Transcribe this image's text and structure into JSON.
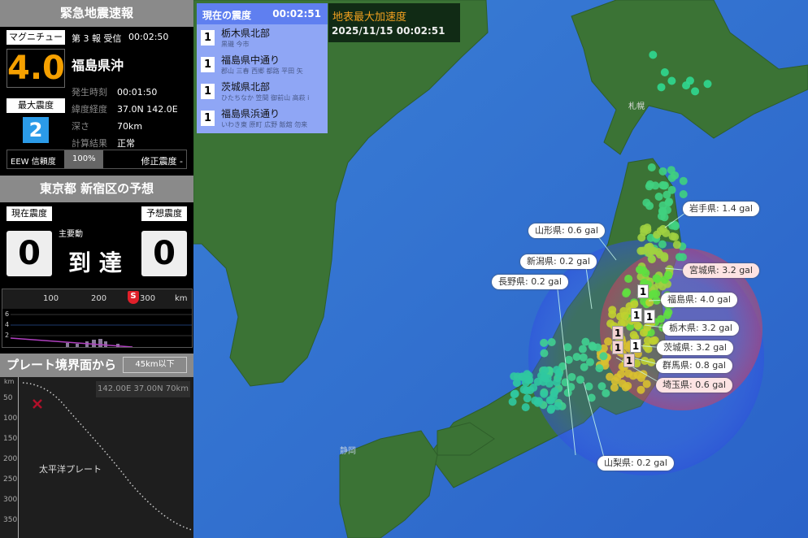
{
  "eew": {
    "title": "緊急地震速報",
    "magnitude_label": "マグニチュード",
    "magnitude": "4.0",
    "report": "第 3 報 受信",
    "received_time": "00:02:50",
    "region": "福島県沖",
    "max_intensity_label": "最大震度",
    "max_intensity": "2",
    "fields": [
      {
        "label": "発生時刻",
        "value": "00:01:50"
      },
      {
        "label": "緯度経度",
        "value": "37.0N 142.0E"
      },
      {
        "label": "深さ",
        "value": "70km"
      },
      {
        "label": "計算結果",
        "value": "正常"
      }
    ],
    "reliability_label": "EEW 信頼度",
    "reliability": "100%",
    "corrected_label": "修正震度 -"
  },
  "forecast": {
    "title": "東京都 新宿区の予想",
    "current_label": "現在震度",
    "current": "0",
    "predicted_label": "予想震度",
    "predicted": "0",
    "main_motion_label": "主要動",
    "status": "到 達",
    "distance_ticks": [
      "100",
      "200",
      "300"
    ],
    "distance_unit": "km",
    "s_wave_label": "S",
    "y_ticks": [
      "6",
      "4",
      "2"
    ]
  },
  "plate": {
    "title": "プレート境界面から",
    "filter": "45km以下",
    "coords": "142.00E 37.00N  70km",
    "y_unit": "km",
    "y_ticks": [
      "50",
      "100",
      "150",
      "200",
      "250",
      "300",
      "350"
    ],
    "plate_name": "太平洋プレート"
  },
  "intensity_list": {
    "title": "現在の震度",
    "time": "00:02:51",
    "items": [
      {
        "level": "1",
        "region": "栃木県北部",
        "cities": "黒磯 今市"
      },
      {
        "level": "1",
        "region": "福島県中通り",
        "cities": "郡山 三春 西郷 都路 平田 矢"
      },
      {
        "level": "1",
        "region": "茨城県北部",
        "cities": "ひたちなか 笠間 御前山 高萩 i"
      },
      {
        "level": "1",
        "region": "福島県浜通り",
        "cities": "いわき東 原町 広野 飯舘 勿来"
      }
    ]
  },
  "pga": {
    "title": "地表最大加速度",
    "datetime": "2025/11/15 00:02:51"
  },
  "map": {
    "city_sapporo": "札幌",
    "city_shizuoka": "静岡",
    "accent_red": "#e0202a",
    "intensity_blue": "#2b9be8",
    "magnitude_orange": "#f5a000",
    "pref_labels": [
      {
        "text": "岩手県: 1.4 gal",
        "hl": false
      },
      {
        "text": "山形県: 0.6 gal",
        "hl": false
      },
      {
        "text": "新潟県: 0.2 gal",
        "hl": false
      },
      {
        "text": "宮城県: 3.2 gal",
        "hl": true
      },
      {
        "text": "長野県: 0.2 gal",
        "hl": false
      },
      {
        "text": "福島県: 4.0 gal",
        "hl": false
      },
      {
        "text": "栃木県: 3.2 gal",
        "hl": false
      },
      {
        "text": "茨城県: 3.2 gal",
        "hl": false
      },
      {
        "text": "群馬県: 0.8 gal",
        "hl": false
      },
      {
        "text": "埼玉県: 0.6 gal",
        "hl": true
      },
      {
        "text": "山梨県: 0.2 gal",
        "hl": false
      }
    ],
    "station_marker": "1"
  }
}
